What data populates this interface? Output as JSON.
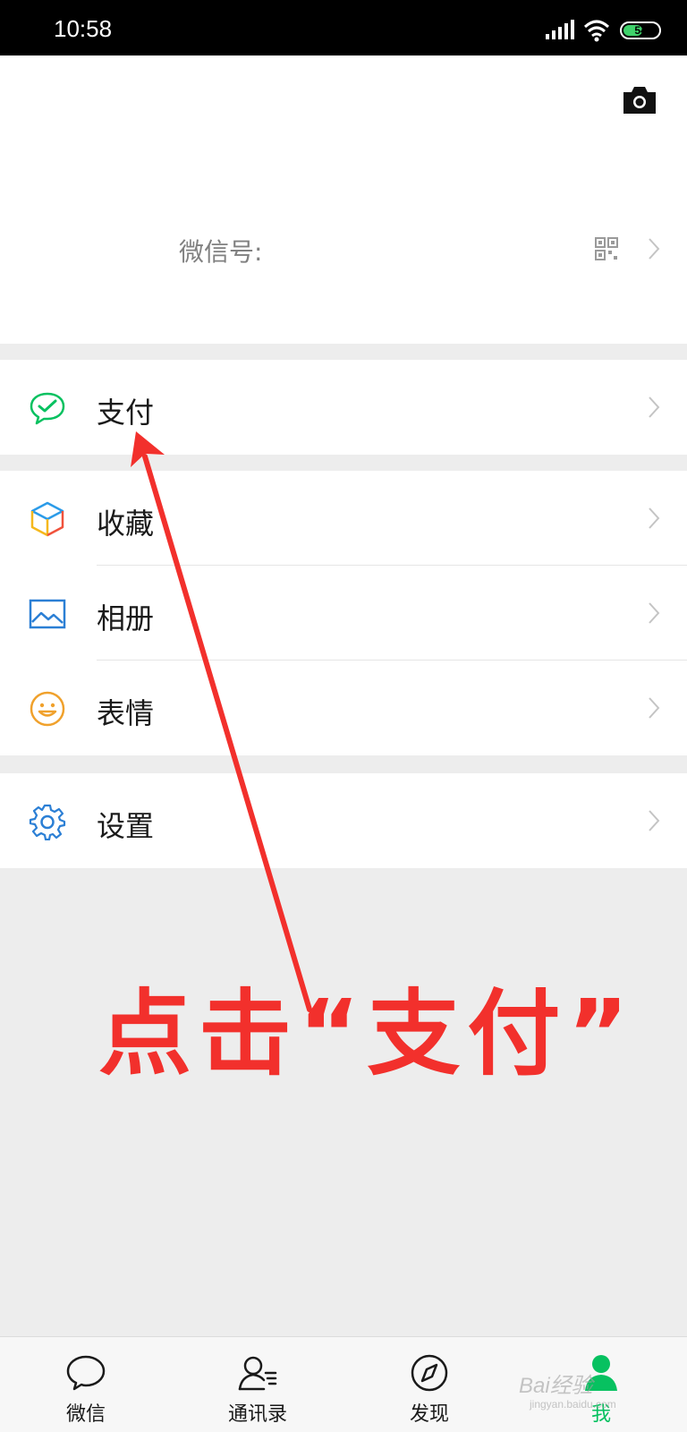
{
  "status_bar": {
    "time": "10:58",
    "battery_level": "54",
    "battery_fraction": 0.54
  },
  "profile": {
    "wechat_id_label": "微信号:",
    "camera_icon": "camera-icon",
    "qr_icon": "qr-code-icon"
  },
  "menu": {
    "pay": {
      "label": "支付",
      "icon": "wechat-pay-icon",
      "color": "#07c160"
    },
    "favorites": {
      "label": "收藏",
      "icon": "favorites-cube-icon"
    },
    "album": {
      "label": "相册",
      "icon": "album-icon",
      "color": "#2b7fd5"
    },
    "stickers": {
      "label": "表情",
      "icon": "smiley-icon",
      "color": "#f0a12c"
    },
    "settings": {
      "label": "设置",
      "icon": "gear-icon",
      "color": "#2b7fd5"
    }
  },
  "annotation": {
    "text": "点击“支付”",
    "color": "#f2302c"
  },
  "tab_bar": {
    "tabs": [
      {
        "label": "微信",
        "icon": "chat-bubble-icon",
        "active": false
      },
      {
        "label": "通讯录",
        "icon": "contacts-icon",
        "active": false
      },
      {
        "label": "发现",
        "icon": "compass-icon",
        "active": false
      },
      {
        "label": "我",
        "icon": "me-person-icon",
        "active": true
      }
    ],
    "active_color": "#07c160"
  },
  "watermark": {
    "text": "Bai经验",
    "sub": "jingyan.baidu.com"
  }
}
